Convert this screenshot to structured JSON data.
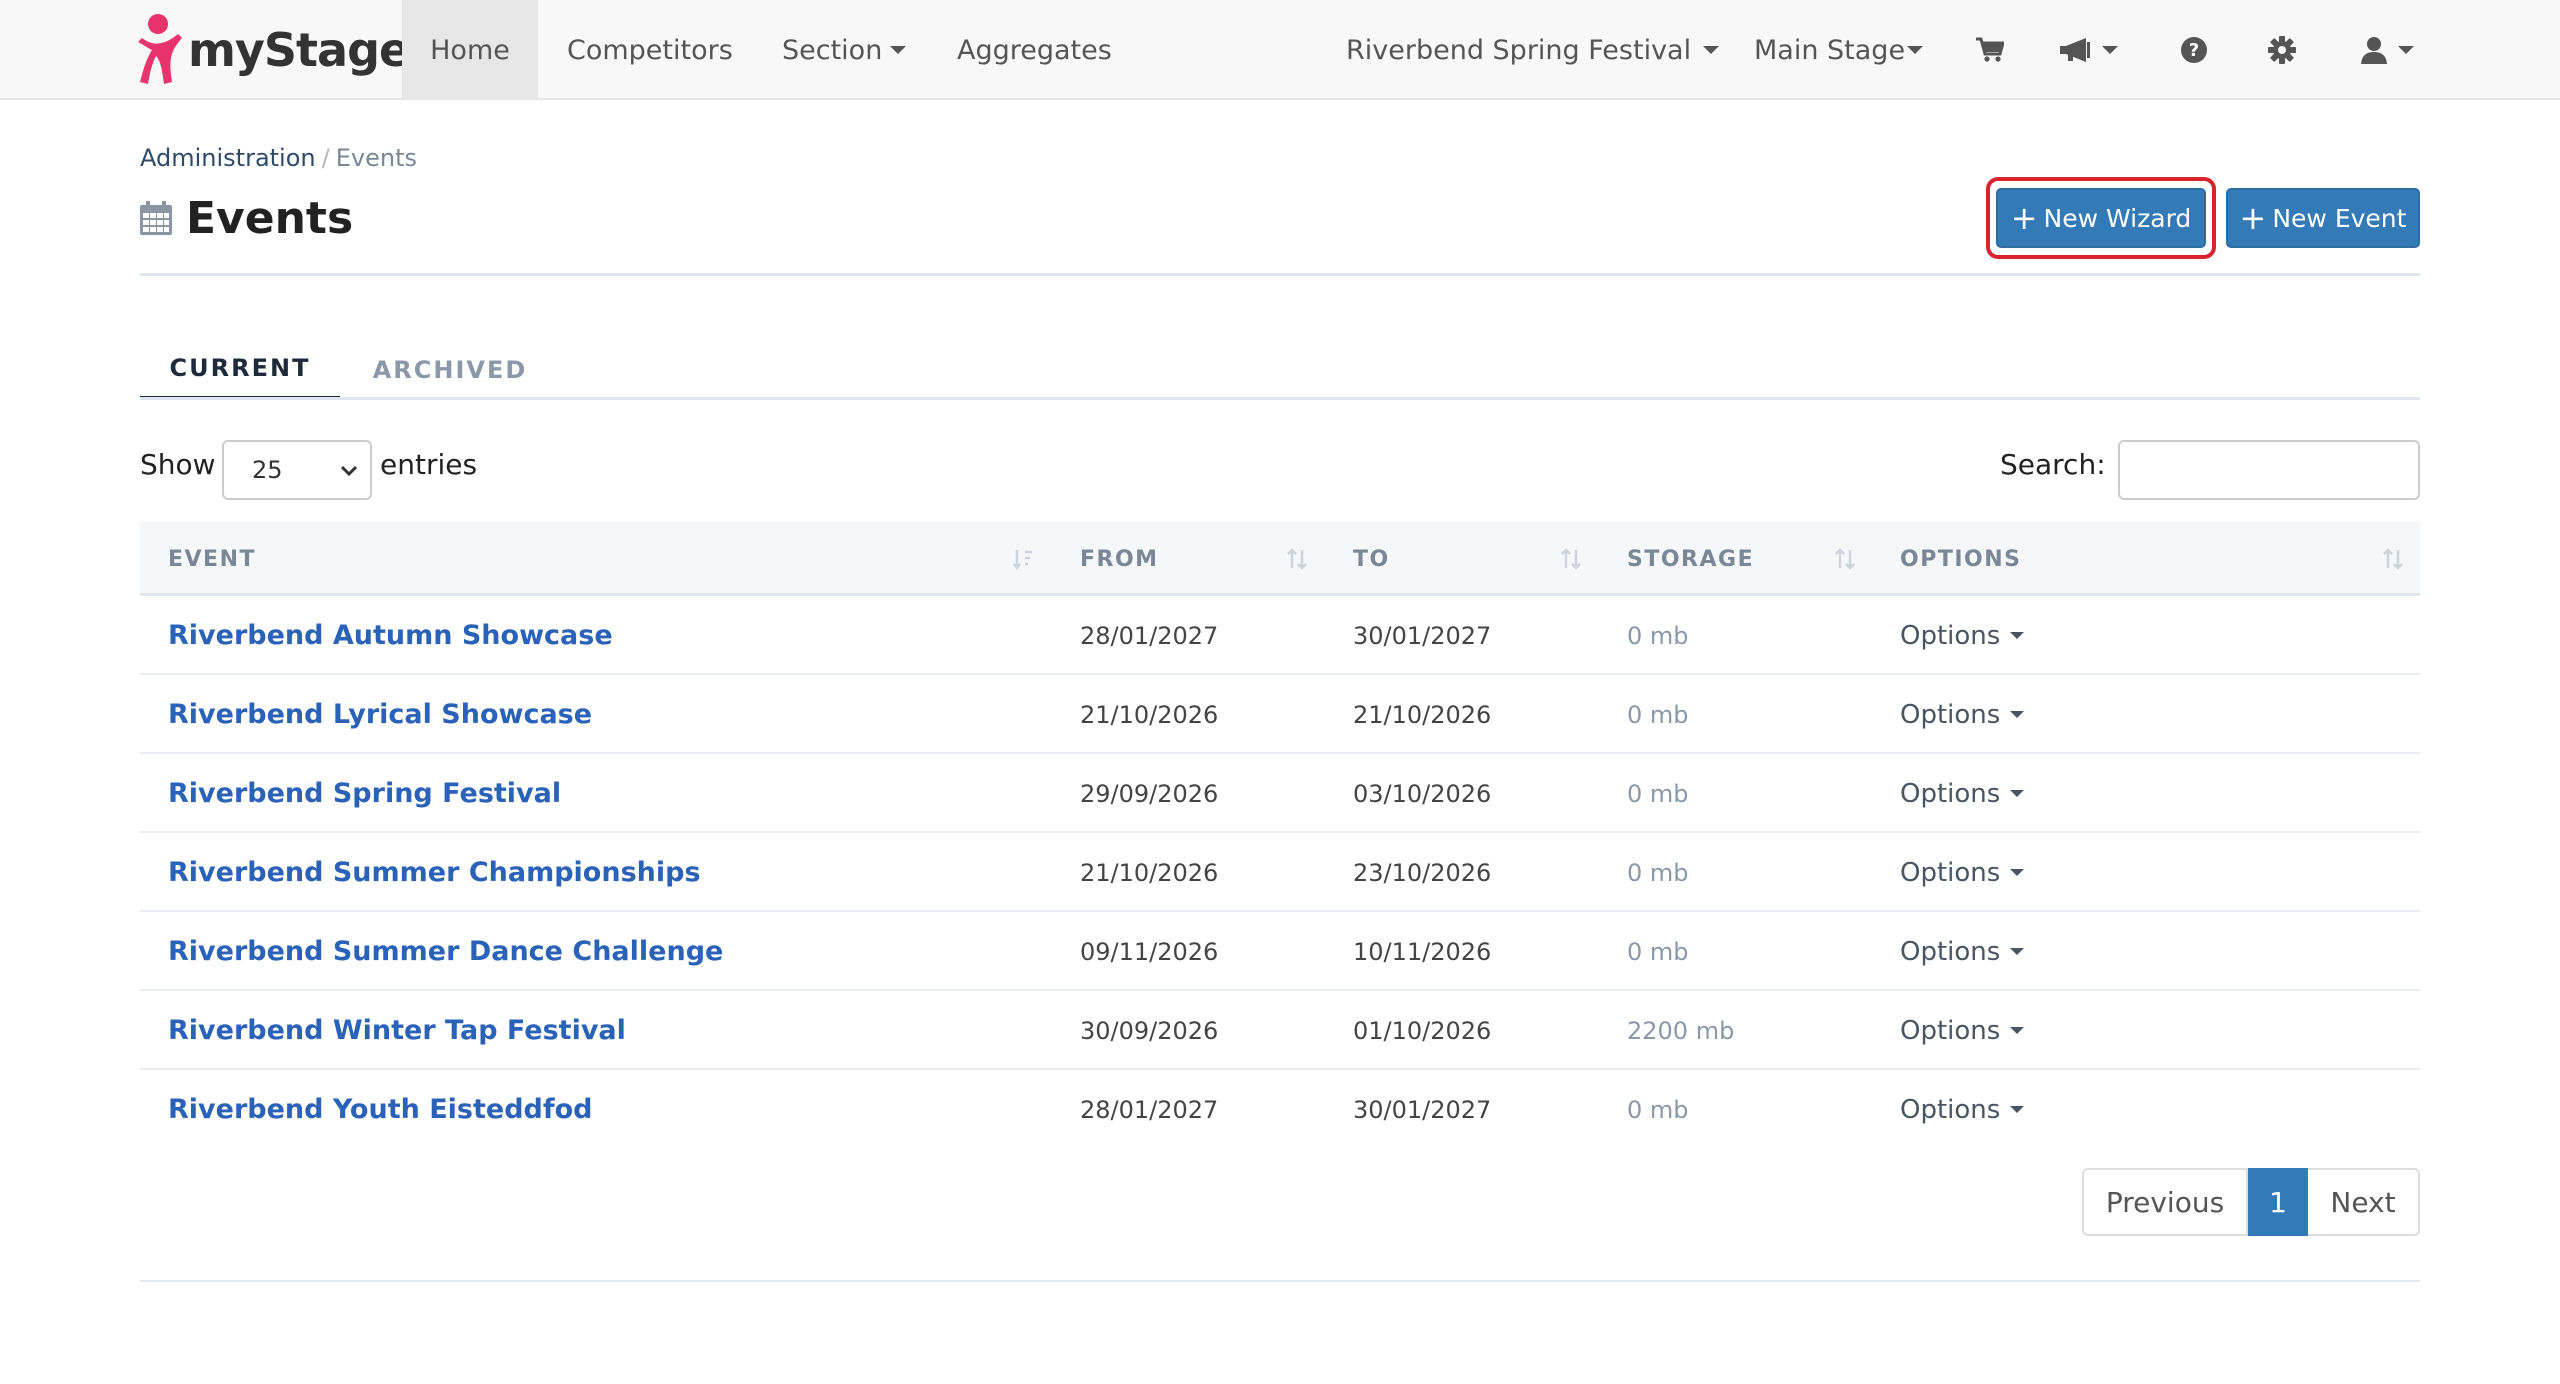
{
  "brand": {
    "name": "myStage"
  },
  "nav": {
    "home": "Home",
    "competitors": "Competitors",
    "section": "Section",
    "aggregates": "Aggregates",
    "event_select": "Riverbend Spring Festival",
    "stage_select": "Main Stage",
    "icons": [
      "cart-icon",
      "bullhorn-icon",
      "help-icon",
      "gear-icon",
      "user-icon"
    ]
  },
  "breadcrumb": {
    "parent": "Administration",
    "separator": "/",
    "current": "Events"
  },
  "page": {
    "title": "Events"
  },
  "actions": {
    "new_wizard": "New Wizard",
    "new_event": "New Event",
    "plus": "+"
  },
  "tabs": {
    "current": "CURRENT",
    "archived": "ARCHIVED"
  },
  "controls": {
    "show_label": "Show",
    "page_length": "25",
    "entries_label": "entries",
    "search_label": "Search:",
    "search_value": ""
  },
  "table": {
    "headers": {
      "event": "EVENT",
      "from": "FROM",
      "to": "TO",
      "storage": "STORAGE",
      "options": "OPTIONS"
    },
    "rows": [
      {
        "event": "Riverbend Autumn Showcase",
        "from": "28/01/2027",
        "to": "30/01/2027",
        "storage": "0 mb",
        "options": "Options"
      },
      {
        "event": "Riverbend Lyrical Showcase",
        "from": "21/10/2026",
        "to": "21/10/2026",
        "storage": "0 mb",
        "options": "Options"
      },
      {
        "event": "Riverbend Spring Festival",
        "from": "29/09/2026",
        "to": "03/10/2026",
        "storage": "0 mb",
        "options": "Options"
      },
      {
        "event": "Riverbend Summer Championships",
        "from": "21/10/2026",
        "to": "23/10/2026",
        "storage": "0 mb",
        "options": "Options"
      },
      {
        "event": "Riverbend Summer Dance Challenge",
        "from": "09/11/2026",
        "to": "10/11/2026",
        "storage": "0 mb",
        "options": "Options"
      },
      {
        "event": "Riverbend Winter Tap Festival",
        "from": "30/09/2026",
        "to": "01/10/2026",
        "storage": "2200 mb",
        "options": "Options"
      },
      {
        "event": "Riverbend Youth Eisteddfod",
        "from": "28/01/2027",
        "to": "30/01/2027",
        "storage": "0 mb",
        "options": "Options"
      }
    ]
  },
  "pagination": {
    "previous": "Previous",
    "current": "1",
    "next": "Next"
  },
  "colors": {
    "primary": "#337ab7",
    "link": "#2a62b8",
    "highlight": "#d9232e",
    "brand_pink": "#e8336f"
  }
}
